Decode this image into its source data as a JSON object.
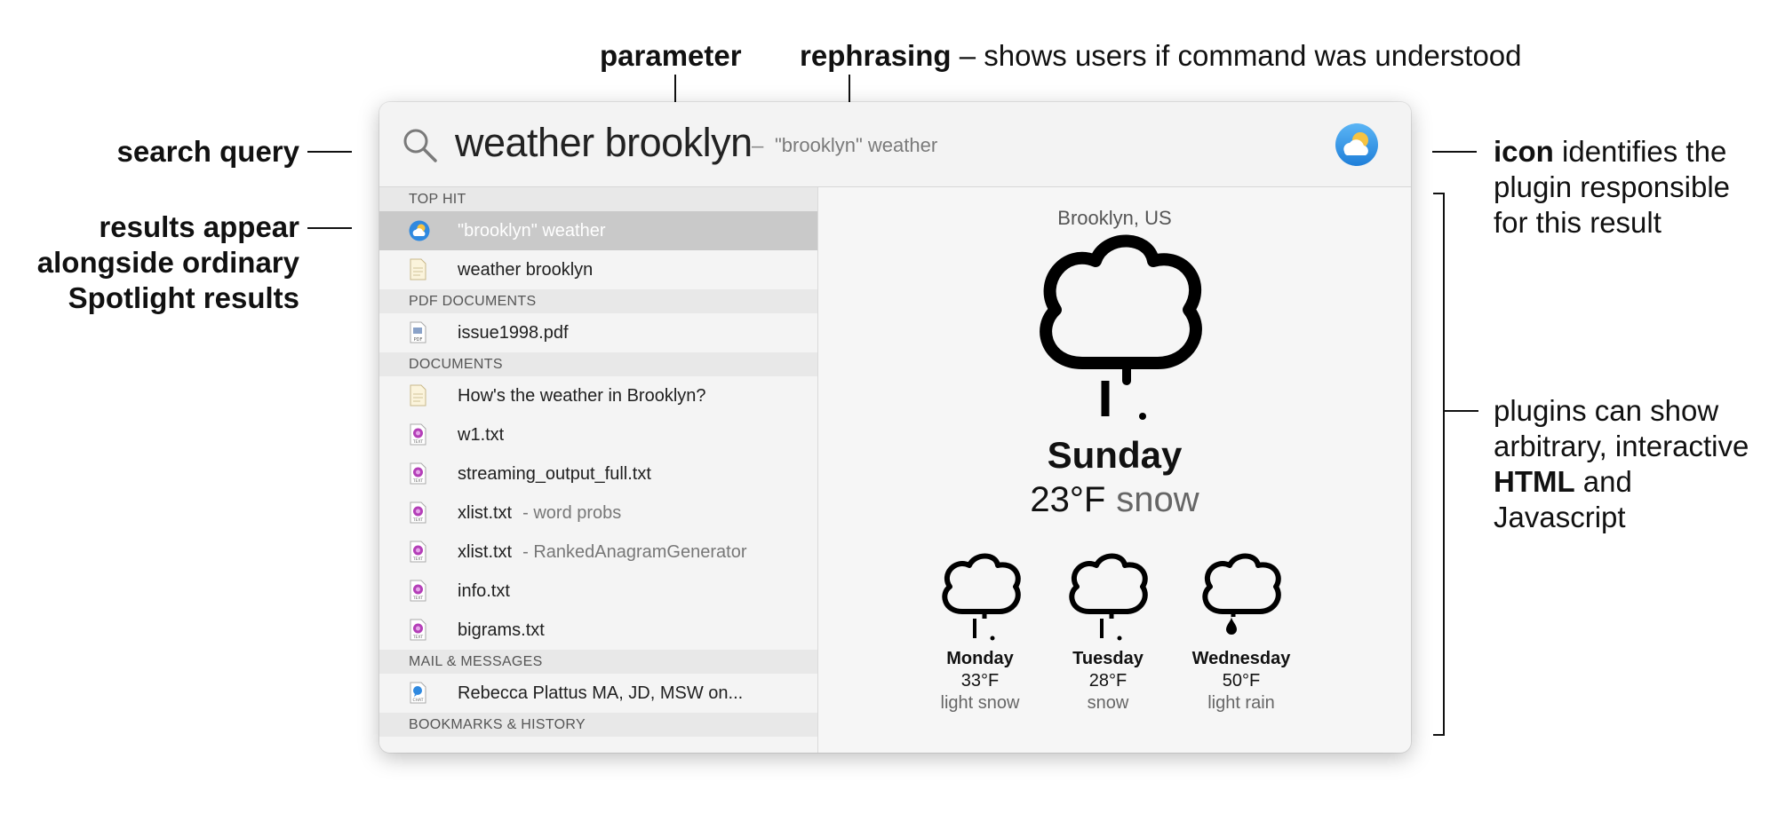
{
  "annotations": {
    "parameter": "parameter",
    "rephrasing_bold": "rephrasing",
    "rephrasing_rest": " – shows users if command was understood",
    "search_query": "search query",
    "results_appear": [
      "results appear",
      "alongside ordinary",
      "Spotlight results"
    ],
    "icon_bold": "icon",
    "icon_rest_1": " identifies the",
    "icon_rest_2": "plugin responsible",
    "icon_rest_3": "for this result",
    "plugins_1": "plugins can show",
    "plugins_2": "arbitrary, interactive",
    "plugins_html": "HTML",
    "plugins_and": " and",
    "plugins_4": "Javascript"
  },
  "search": {
    "query": "weather brooklyn",
    "dash": "–",
    "rephrase": "\"brooklyn\" weather"
  },
  "results": {
    "sections": [
      "TOP HIT",
      "PDF DOCUMENTS",
      "DOCUMENTS",
      "MAIL & MESSAGES",
      "BOOKMARKS & HISTORY"
    ],
    "items": [
      {
        "label": "\"brooklyn\" weather",
        "sub": "",
        "icon": "weather-plugin-icon"
      },
      {
        "label": "weather brooklyn",
        "sub": "",
        "icon": "document-icon"
      },
      {
        "label": "issue1998.pdf",
        "sub": "",
        "icon": "pdf-icon"
      },
      {
        "label": "How's the weather in Brooklyn?",
        "sub": "",
        "icon": "document-icon"
      },
      {
        "label": "w1.txt",
        "sub": "",
        "icon": "text-file-icon"
      },
      {
        "label": "streaming_output_full.txt",
        "sub": "",
        "icon": "text-file-icon"
      },
      {
        "label": "xlist.txt",
        "sub": "- word probs",
        "icon": "text-file-icon"
      },
      {
        "label": "xlist.txt",
        "sub": "- RankedAnagramGenerator",
        "icon": "text-file-icon"
      },
      {
        "label": "info.txt",
        "sub": "",
        "icon": "text-file-icon"
      },
      {
        "label": "bigrams.txt",
        "sub": "",
        "icon": "text-file-icon"
      },
      {
        "label": "Rebecca Plattus MA, JD, MSW on...",
        "sub": "",
        "icon": "chat-icon"
      }
    ]
  },
  "weather": {
    "city": "Brooklyn, US",
    "day": "Sunday",
    "temp": "23°F",
    "condition": "snow",
    "forecast": [
      {
        "day": "Monday",
        "temp": "33°F",
        "condition": "light snow"
      },
      {
        "day": "Tuesday",
        "temp": "28°F",
        "condition": "snow"
      },
      {
        "day": "Wednesday",
        "temp": "50°F",
        "condition": "light rain"
      }
    ]
  },
  "colors": {
    "accent_blue": "#3a8fe0",
    "sun_yellow": "#f6c342",
    "selection": "#c9c9c9"
  }
}
